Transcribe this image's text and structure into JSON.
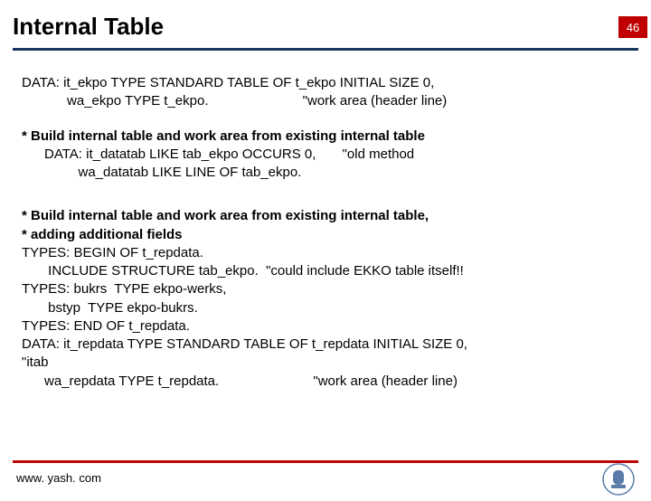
{
  "page_number": "46",
  "title": "Internal Table",
  "block1": {
    "l1": "DATA: it_ekpo TYPE STANDARD TABLE OF t_ekpo INITIAL SIZE 0,",
    "l2": "            wa_ekpo TYPE t_ekpo.                         \"work area (header line)"
  },
  "block2": {
    "h": "* Build internal table and work area from existing internal table",
    "l1": "      DATA: it_datatab LIKE tab_ekpo OCCURS 0,       \"old method",
    "l2": "               wa_datatab LIKE LINE OF tab_ekpo."
  },
  "block3": {
    "h1": "* Build internal table and work area from existing internal table,",
    "h2": "* adding additional fields",
    "l1": "TYPES: BEGIN OF t_repdata.",
    "l2": "       INCLUDE STRUCTURE tab_ekpo.  \"could include EKKO table itself!!",
    "l3": "TYPES: bukrs  TYPE ekpo-werks,",
    "l4": "       bstyp  TYPE ekpo-bukrs.",
    "l5": "TYPES: END OF t_repdata.",
    "l6": "DATA: it_repdata TYPE STANDARD TABLE OF t_repdata INITIAL SIZE 0,   ",
    "l7": "\"itab",
    "l8": "      wa_repdata TYPE t_repdata.                         \"work area (header line)"
  },
  "footer_url": "www. yash. com"
}
